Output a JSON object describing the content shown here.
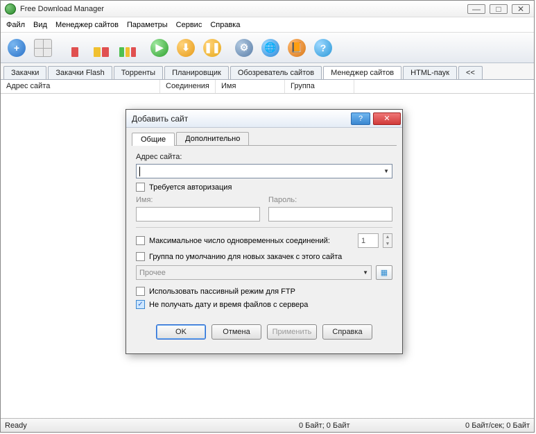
{
  "app": {
    "title": "Free Download Manager"
  },
  "menu": [
    "Файл",
    "Вид",
    "Менеджер сайтов",
    "Параметры",
    "Сервис",
    "Справка"
  ],
  "tabs": [
    "Закачки",
    "Закачки Flash",
    "Торренты",
    "Планировщик",
    "Обозреватель сайтов",
    "Менеджер сайтов",
    "HTML-паук",
    "<<"
  ],
  "active_tab_index": 5,
  "columns": [
    "Адрес сайта",
    "Соединения",
    "Имя",
    "Группа"
  ],
  "status": {
    "left": "Ready",
    "mid": "0 Байт; 0 Байт",
    "right": "0 Байт/сек; 0 Байт"
  },
  "dialog": {
    "title": "Добавить сайт",
    "tabs": [
      "Общие",
      "Дополнительно"
    ],
    "active_tab_index": 0,
    "labels": {
      "site_address": "Адрес сайта:",
      "auth_required": "Требуется авторизация",
      "username": "Имя:",
      "password": "Пароль:",
      "max_conn": "Максимальное число одновременных соединений:",
      "default_group": "Группа по умолчанию для новых закачек с этого сайта",
      "group_value": "Прочее",
      "ftp_passive": "Использовать пассивный режим для FTP",
      "no_filedate": "Не получать дату и время файлов с сервера",
      "max_conn_value": "1"
    },
    "checks": {
      "auth_required": false,
      "max_conn": false,
      "default_group": false,
      "ftp_passive": false,
      "no_filedate": true
    },
    "buttons": {
      "ok": "OK",
      "cancel": "Отмена",
      "apply": "Применить",
      "help": "Справка"
    }
  }
}
